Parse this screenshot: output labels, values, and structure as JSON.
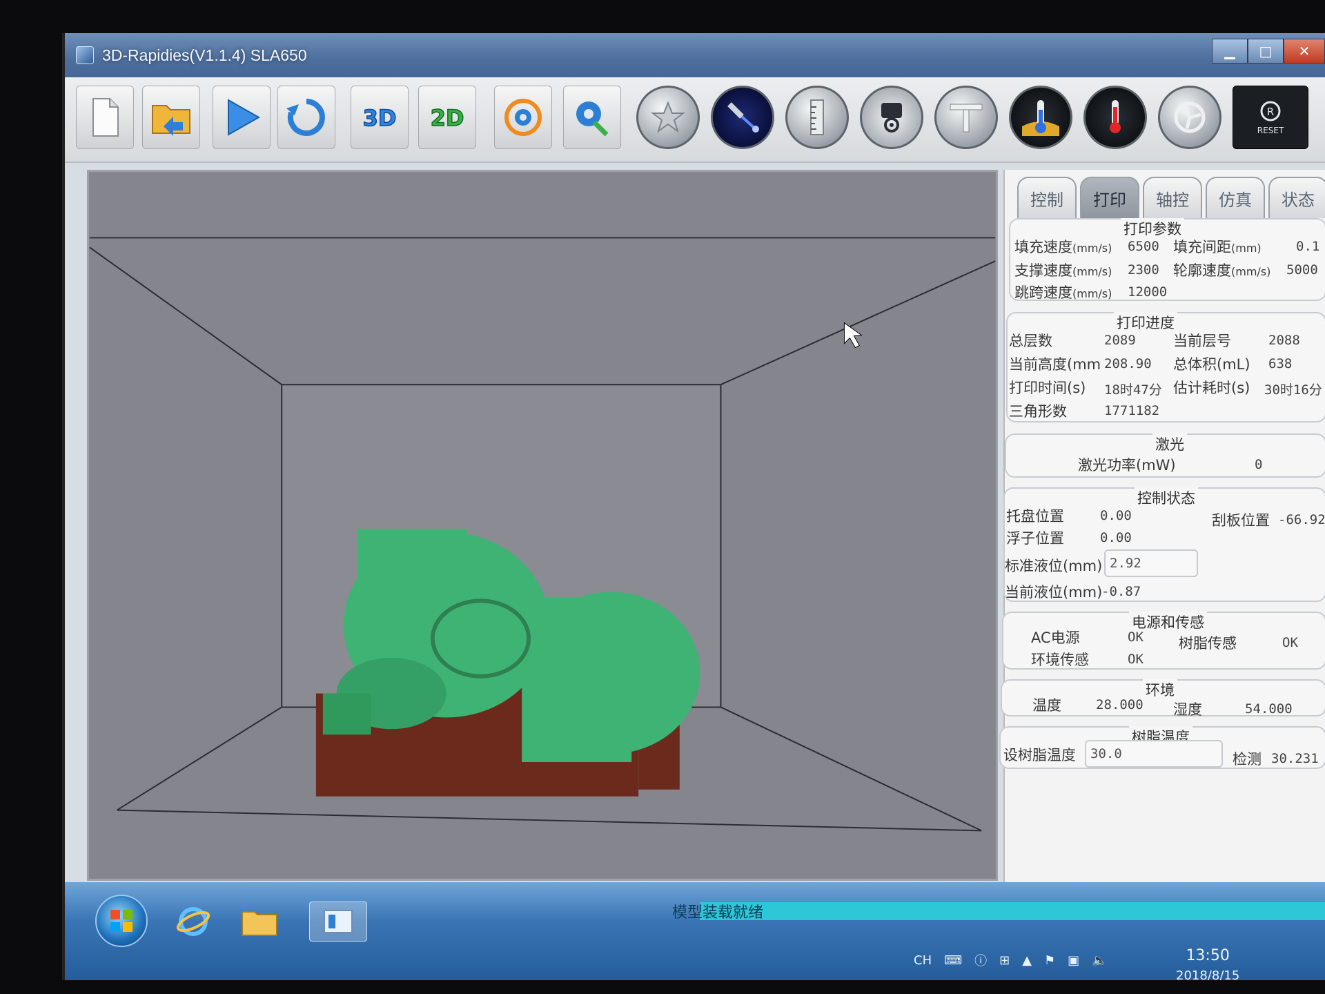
{
  "window": {
    "title": "3D-Rapidies(V1.1.4) SLA650",
    "controls": [
      "minimize-icon",
      "maximize-icon",
      "close-icon"
    ]
  },
  "toolbar": {
    "buttons": [
      {
        "name": "new-file-button",
        "icon": "document-icon"
      },
      {
        "name": "open-file-button",
        "icon": "folder-arrow-icon"
      },
      {
        "name": "start-print-button",
        "icon": "play-icon"
      },
      {
        "name": "refresh-button",
        "icon": "refresh-icon"
      },
      {
        "name": "view-3d-button",
        "icon": "3d-icon",
        "label": "3D"
      },
      {
        "name": "view-2d-button",
        "icon": "2d-icon",
        "label": "2D"
      },
      {
        "name": "settings-cycle-button",
        "icon": "gear-refresh-icon"
      },
      {
        "name": "tools-settings-button",
        "icon": "gear-wrench-icon"
      },
      {
        "name": "home-button",
        "icon": "star-icon"
      },
      {
        "name": "laser-button",
        "icon": "laser-icon"
      },
      {
        "name": "level-button",
        "icon": "ruler-icon"
      },
      {
        "name": "motor-button",
        "icon": "motor-icon"
      },
      {
        "name": "scraper-button",
        "icon": "t-handle-icon"
      },
      {
        "name": "resin-temp-button",
        "icon": "thermometer-blue-icon"
      },
      {
        "name": "heater-button",
        "icon": "thermometer-red-icon"
      },
      {
        "name": "fan-button",
        "icon": "fan-icon"
      },
      {
        "name": "reset-button",
        "icon": "reset-icon",
        "label": "RESET"
      }
    ]
  },
  "tabs": [
    {
      "label": "控制",
      "active": false
    },
    {
      "label": "打印",
      "active": true
    },
    {
      "label": "轴控",
      "active": false
    },
    {
      "label": "仿真",
      "active": false
    },
    {
      "label": "状态",
      "active": false
    }
  ],
  "print_params": {
    "title": "打印参数",
    "fill_speed_label": "填充速度",
    "fill_speed_unit": "(mm/s)",
    "fill_speed": "6500",
    "fill_spacing_label": "填充间距",
    "fill_spacing_unit": "(mm)",
    "fill_spacing": "0.1",
    "support_speed_label": "支撑速度",
    "support_speed_unit": "(mm/s)",
    "support_speed": "2300",
    "contour_speed_label": "轮廓速度",
    "contour_speed_unit": "(mm/s)",
    "contour_speed": "5000",
    "jump_speed_label": "跳跨速度",
    "jump_speed_unit": "(mm/s)",
    "jump_speed": "12000"
  },
  "print_progress": {
    "title": "打印进度",
    "total_layers_label": "总层数",
    "total_layers": "2089",
    "current_layer_label": "当前层号",
    "current_layer": "2088",
    "current_height_label": "当前高度(mm",
    "current_height": "208.90",
    "total_volume_label": "总体积(mL)",
    "total_volume": "638",
    "print_time_label": "打印时间(s)",
    "print_time": "18时47分",
    "est_time_label": "估计耗时(s)",
    "est_time": "30时16分",
    "triangles_label": "三角形数",
    "triangles": "1771182"
  },
  "laser": {
    "title": "激光",
    "power_label": "激光功率(mW)",
    "power": "0"
  },
  "control_status": {
    "title": "控制状态",
    "tray_pos_label": "托盘位置",
    "tray_pos": "0.00",
    "scraper_pos_label": "刮板位置",
    "scraper_pos": "-66.92",
    "float_pos_label": "浮子位置",
    "float_pos": "0.00",
    "std_level_label": "标准液位(mm)",
    "std_level": "2.92",
    "cur_level_label": "当前液位(mm)",
    "cur_level": "-0.87"
  },
  "power_sensor": {
    "title": "电源和传感",
    "ac_label": "AC电源",
    "ac": "OK",
    "resin_sensor_label": "树脂传感",
    "resin_sensor": "OK",
    "env_sensor_label": "环境传感",
    "env_sensor": "OK"
  },
  "environment": {
    "title": "环境",
    "temp_label": "温度",
    "temp": "28.000",
    "humidity_label": "湿度",
    "humidity": "54.000"
  },
  "resin_temp": {
    "title": "树脂温度",
    "set_label": "设树脂温度",
    "set_value": "30.0",
    "detect_label": "检测",
    "detect_value": "30.231"
  },
  "taskbar": {
    "status_text": "模型装载就绪",
    "lang": "CH",
    "time": "13:50",
    "date": "2018/8/15"
  },
  "colors": {
    "model": "#3fb374",
    "support": "#6b2a1c",
    "viewport_bg": "#85858d",
    "status_strip": "#2ec7d8"
  }
}
